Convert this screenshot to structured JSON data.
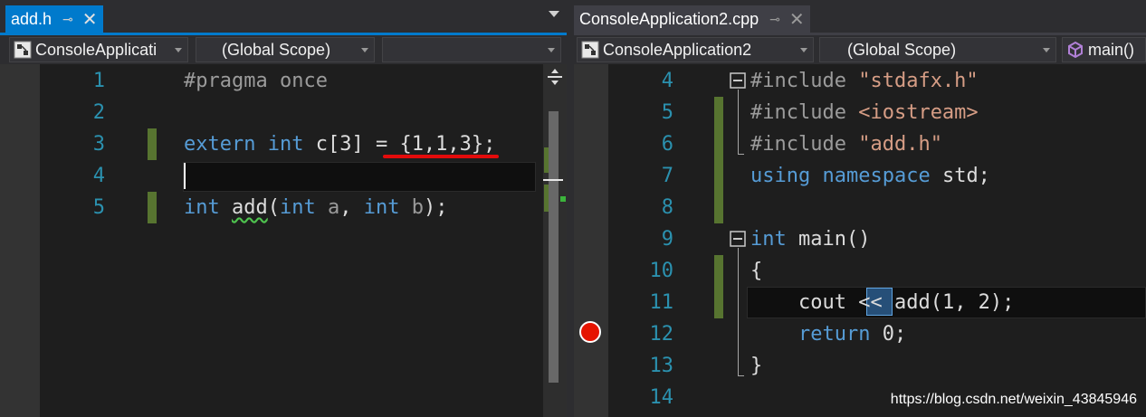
{
  "left_pane": {
    "tab": {
      "label": "add.h",
      "pin": "⊸",
      "close": "✕"
    },
    "nav": {
      "project": "ConsoleApplicati",
      "scope": "(Global Scope)",
      "member": ""
    },
    "lines": [
      {
        "n": "1",
        "tokens": [
          {
            "c": "pp",
            "t": "#pragma once"
          }
        ]
      },
      {
        "n": "2",
        "tokens": []
      },
      {
        "n": "3",
        "tokens": [
          {
            "c": "kw",
            "t": "extern"
          },
          {
            "c": "var",
            "t": " "
          },
          {
            "c": "kw",
            "t": "int"
          },
          {
            "c": "var",
            "t": " c[3] = {1,1,3};"
          }
        ]
      },
      {
        "n": "4",
        "tokens": []
      },
      {
        "n": "5",
        "tokens": [
          {
            "c": "kw",
            "t": "int"
          },
          {
            "c": "var",
            "t": " "
          },
          {
            "c": "var squig",
            "t": "add"
          },
          {
            "c": "var",
            "t": "("
          },
          {
            "c": "kw",
            "t": "int"
          },
          {
            "c": "param",
            "t": " a"
          },
          {
            "c": "var",
            "t": ", "
          },
          {
            "c": "kw",
            "t": "int"
          },
          {
            "c": "param",
            "t": " b"
          },
          {
            "c": "var",
            "t": ");"
          }
        ]
      }
    ]
  },
  "right_pane": {
    "tab": {
      "label": "ConsoleApplication2.cpp",
      "pin": "⊸",
      "close": "✕"
    },
    "nav": {
      "project": "ConsoleApplication2",
      "scope": "(Global Scope)",
      "member": "main()"
    },
    "lines": [
      {
        "n": "4",
        "tokens": [
          {
            "c": "pp",
            "t": "#include "
          },
          {
            "c": "str",
            "t": "\"stdafx.h\""
          }
        ]
      },
      {
        "n": "5",
        "tokens": [
          {
            "c": "pp",
            "t": "#include "
          },
          {
            "c": "str",
            "t": "<iostream>"
          }
        ]
      },
      {
        "n": "6",
        "tokens": [
          {
            "c": "pp",
            "t": "#include "
          },
          {
            "c": "str",
            "t": "\"add.h\""
          }
        ]
      },
      {
        "n": "7",
        "tokens": [
          {
            "c": "kw",
            "t": "using"
          },
          {
            "c": "var",
            "t": " "
          },
          {
            "c": "kw",
            "t": "namespace"
          },
          {
            "c": "var",
            "t": " std;"
          }
        ]
      },
      {
        "n": "8",
        "tokens": []
      },
      {
        "n": "9",
        "tokens": [
          {
            "c": "kw",
            "t": "int"
          },
          {
            "c": "var",
            "t": " main()"
          }
        ]
      },
      {
        "n": "10",
        "tokens": [
          {
            "c": "var",
            "t": "{"
          }
        ]
      },
      {
        "n": "11",
        "tokens": [
          {
            "c": "var",
            "t": "    cout "
          },
          {
            "c": "var",
            "t": "<<"
          },
          {
            "c": "var",
            "t": " add(1, 2);"
          }
        ]
      },
      {
        "n": "12",
        "tokens": [
          {
            "c": "var",
            "t": "    "
          },
          {
            "c": "kw",
            "t": "return"
          },
          {
            "c": "var",
            "t": " 0;"
          }
        ]
      },
      {
        "n": "13",
        "tokens": [
          {
            "c": "var",
            "t": "}"
          }
        ]
      },
      {
        "n": "14",
        "tokens": []
      }
    ]
  },
  "watermark": "https://blog.csdn.net/weixin_43845946",
  "colors": {
    "accent": "#007acc",
    "breakpoint": "#e51400",
    "changed": "#577430"
  }
}
